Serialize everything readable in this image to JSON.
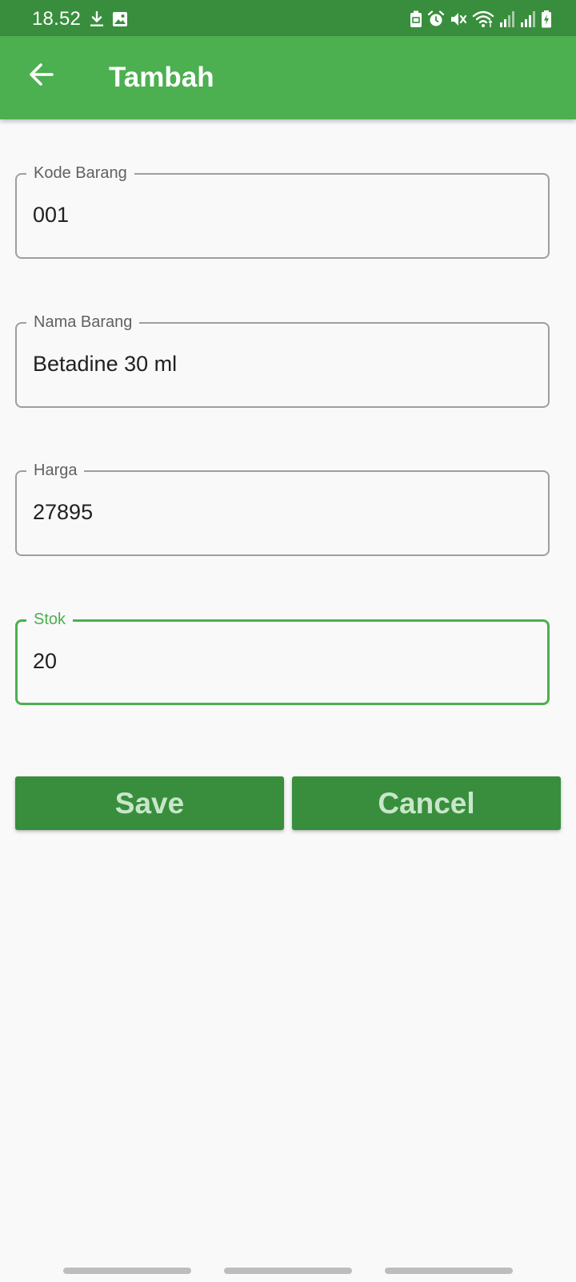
{
  "status_bar": {
    "time": "18.52",
    "icons_left": [
      "download-icon",
      "image-icon"
    ],
    "icons_right": [
      "screenshot-icon",
      "alarm-icon",
      "mute-icon",
      "wifi-icon",
      "signal-icon",
      "signal-icon",
      "battery-charging-icon"
    ]
  },
  "app_bar": {
    "back_icon": "arrow-left-icon",
    "title": "Tambah"
  },
  "form": {
    "fields": [
      {
        "label": "Kode Barang",
        "value": "001",
        "focused": false
      },
      {
        "label": "Nama Barang",
        "value": "Betadine 30 ml",
        "focused": false
      },
      {
        "label": "Harga",
        "value": "27895",
        "focused": false
      },
      {
        "label": "Stok",
        "value": "20",
        "focused": true
      }
    ],
    "save_label": "Save",
    "cancel_label": "Cancel"
  },
  "colors": {
    "status_bar": "#388e3c",
    "app_bar": "#4caf50",
    "button_bg": "#388e3c",
    "button_text": "#c8e6c9",
    "focus_accent": "#4caf50",
    "border": "#9e9e9e",
    "background": "#f9f9f9"
  }
}
